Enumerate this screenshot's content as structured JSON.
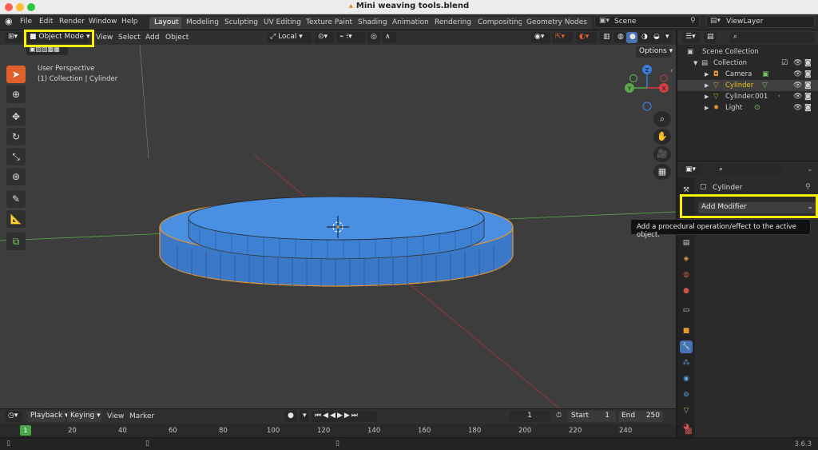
{
  "window": {
    "title": "Mini weaving tools.blend"
  },
  "topbar": {
    "menus": [
      "File",
      "Edit",
      "Render",
      "Window",
      "Help"
    ],
    "workspace_tabs": [
      "Layout",
      "Modeling",
      "Sculpting",
      "UV Editing",
      "Texture Paint",
      "Shading",
      "Animation",
      "Rendering",
      "Compositing",
      "Geometry Nodes"
    ],
    "active_tab": "Layout",
    "scene_name": "Scene",
    "view_layer": "ViewLayer"
  },
  "viewport": {
    "mode": "Object Mode",
    "menus": [
      "View",
      "Select",
      "Add",
      "Object"
    ],
    "transform_orientation": "Local",
    "options_label": "Options",
    "info_line1": "User Perspective",
    "info_line2": "(1) Collection | Cylinder",
    "gizmo_axes": [
      "X",
      "Y",
      "Z"
    ],
    "colors": {
      "background": "#3d3d3d",
      "object_fill": "#4a8fe0",
      "selection_outline": "#e8962e",
      "x_axis": "#c0392b",
      "y_axis": "#5aa84a",
      "highlight": "#f7f000"
    }
  },
  "outliner": {
    "root": "Scene Collection",
    "collection": "Collection",
    "items": [
      {
        "name": "Camera",
        "icon": "camera-icon",
        "selected": false
      },
      {
        "name": "Cylinder",
        "icon": "mesh-icon",
        "selected": true
      },
      {
        "name": "Cylinder.001",
        "icon": "mesh-icon",
        "selected": false
      },
      {
        "name": "Light",
        "icon": "light-icon",
        "selected": false
      }
    ]
  },
  "properties": {
    "object_name": "Cylinder",
    "add_modifier_label": "Add Modifier",
    "tooltip": "Add a procedural operation/effect to the active object."
  },
  "timeline": {
    "playback_label": "Playback",
    "keying_label": "Keying",
    "view_label": "View",
    "marker_label": "Marker",
    "current_frame": "1",
    "start_label": "Start",
    "start_value": "1",
    "end_label": "End",
    "end_value": "250",
    "ruler": [
      "20",
      "40",
      "60",
      "80",
      "100",
      "120",
      "140",
      "160",
      "180",
      "200",
      "220",
      "240"
    ],
    "playhead_frame": "1"
  },
  "status": {
    "version": "3.6.3"
  }
}
